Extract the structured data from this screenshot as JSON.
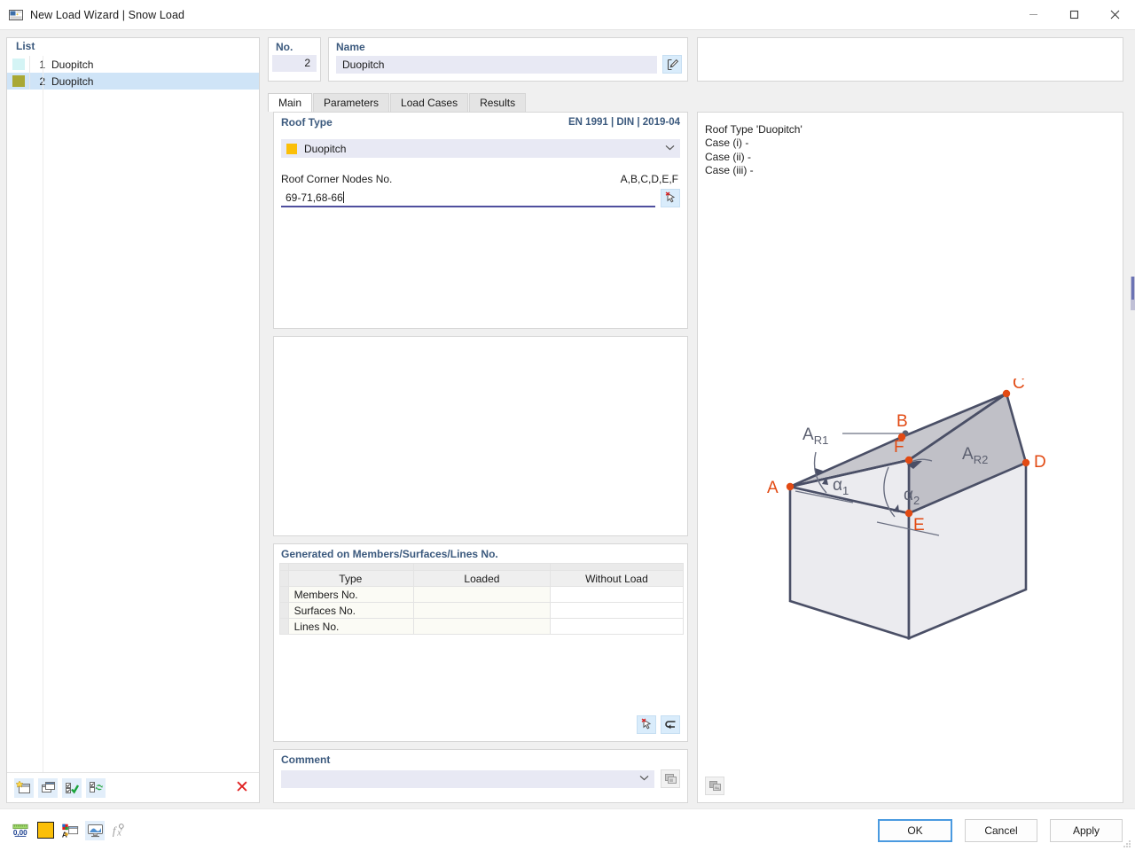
{
  "window": {
    "title": "New Load Wizard | Snow Load",
    "app_icon": "wizard-icon",
    "minimize": "—",
    "maximize": "☐",
    "close": "✕"
  },
  "left": {
    "header": "List",
    "items": [
      {
        "index": "1",
        "label": "Duopitch",
        "color": "#d4f4f5",
        "selected": false
      },
      {
        "index": "2",
        "label": "Duopitch",
        "color": "#a9a835",
        "selected": true
      }
    ],
    "toolbar": [
      {
        "name": "new-item-button",
        "icon": "new-window-icon"
      },
      {
        "name": "copy-item-button",
        "icon": "copy-window-icon"
      },
      {
        "name": "select-all-button",
        "icon": "checkbox-check-icon"
      },
      {
        "name": "invert-selection-button",
        "icon": "checkbox-refresh-icon"
      },
      {
        "name": "delete-item-button",
        "icon": "red-x-icon",
        "glyph": "✕"
      }
    ]
  },
  "header": {
    "no_label": "No.",
    "no_value": "2",
    "name_label": "Name",
    "name_value": "Duopitch",
    "name_placeholder": "",
    "name_edit_icon": "edit-pencil-icon"
  },
  "tabs": [
    {
      "label": "Main",
      "active": true
    },
    {
      "label": "Parameters",
      "active": false
    },
    {
      "label": "Load Cases",
      "active": false
    },
    {
      "label": "Results",
      "active": false
    }
  ],
  "roof_section": {
    "title": "Roof Type",
    "standard": "EN 1991 | DIN | 2019-04",
    "selected_type": "Duopitch",
    "type_color": "#fbbf08",
    "chevron": "⌄",
    "nodes_label": "Roof Corner Nodes No.",
    "nodes_hint": "A,B,C,D,E,F",
    "nodes_value": "69-71,68-66",
    "pick_icon": "pick-cursor-icon"
  },
  "generated": {
    "title": "Generated on Members/Surfaces/Lines No.",
    "columns": [
      "Type",
      "Loaded",
      "Without Load"
    ],
    "rows": [
      {
        "type": "Members No.",
        "loaded": "",
        "without_load": ""
      },
      {
        "type": "Surfaces No.",
        "loaded": "",
        "without_load": ""
      },
      {
        "type": "Lines No.",
        "loaded": "",
        "without_load": ""
      }
    ],
    "tools": [
      {
        "name": "pick-cursor-button",
        "icon": "pick-cursor-icon"
      },
      {
        "name": "reset-button",
        "icon": "undo-arrow-icon"
      }
    ]
  },
  "comment": {
    "title": "Comment",
    "value": "",
    "placeholder": "",
    "chevron": "⌄",
    "browse_icon": "comment-library-icon"
  },
  "preview": {
    "lines": [
      "Roof Type 'Duopitch'",
      "Case (i) -",
      "Case (ii) -",
      "Case (iii) -"
    ],
    "tool_icon": "image-copy-icon",
    "diagram": {
      "type": "duopitch-roof-3d",
      "node_labels": [
        "A",
        "B",
        "C",
        "D",
        "E",
        "F"
      ],
      "area_labels": [
        "A",
        "A"
      ],
      "area_label_subs": [
        "R1",
        "R2"
      ],
      "angle_labels": [
        "α",
        "α"
      ],
      "angle_subs": [
        "1",
        "2"
      ],
      "node_color": "#e24a13",
      "line_color": "#4a4f66",
      "roof_fill_1": "#c6c6cc",
      "roof_fill_2": "#c0c0c6",
      "wall_fill": "#ebebef",
      "text_color": "#5c6070"
    }
  },
  "statusbar": {
    "tools": [
      {
        "name": "numeric-format-button",
        "icon": "ruler-000-icon",
        "label": "0,00"
      },
      {
        "name": "color-swatch-button",
        "icon": "yellow-color-icon"
      },
      {
        "name": "display-properties-button",
        "icon": "display-props-icon"
      },
      {
        "name": "render-view-button",
        "icon": "render-monitor-icon"
      },
      {
        "name": "formula-button",
        "icon": "fx-icon",
        "label": "f"
      }
    ]
  },
  "dialog_buttons": {
    "ok": "OK",
    "cancel": "Cancel",
    "apply": "Apply"
  }
}
